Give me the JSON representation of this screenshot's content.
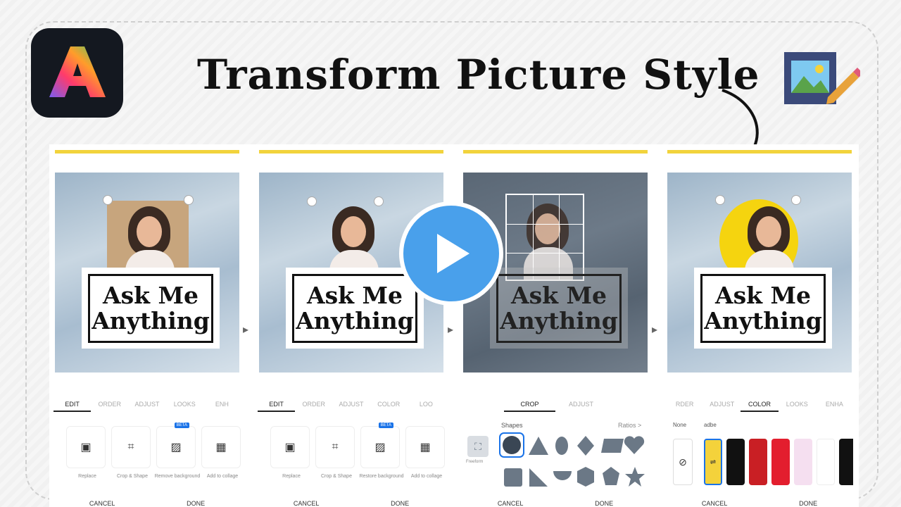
{
  "title": "Transform Picture Style",
  "panels": [
    {
      "tabs": [
        "EDIT",
        "ORDER",
        "ADJUST",
        "LOOKS",
        "ENH"
      ],
      "active": 0,
      "canvas_text": [
        "Ask Me",
        "Anything"
      ],
      "tools": [
        {
          "label": "Replace",
          "icon": "replace-icon"
        },
        {
          "label": "Crop & Shape",
          "icon": "crop-icon"
        },
        {
          "label": "Remove background",
          "icon": "remove-bg-icon",
          "badge": "BETA"
        },
        {
          "label": "Add to collage",
          "icon": "collage-icon"
        }
      ],
      "cancel": "CANCEL",
      "done": "DONE"
    },
    {
      "tabs": [
        "EDIT",
        "ORDER",
        "ADJUST",
        "COLOR",
        "LOO"
      ],
      "active": 0,
      "canvas_text": [
        "Ask Me",
        "Anything"
      ],
      "tools": [
        {
          "label": "Replace",
          "icon": "replace-icon"
        },
        {
          "label": "Crop & Shape",
          "icon": "crop-icon"
        },
        {
          "label": "Restore background",
          "icon": "restore-bg-icon",
          "badge": "BETA"
        },
        {
          "label": "Add to collage",
          "icon": "collage-icon"
        }
      ],
      "cancel": "CANCEL",
      "done": "DONE"
    },
    {
      "tabs": [
        "CROP",
        "ADJUST"
      ],
      "active": 0,
      "canvas_text": [
        "Ask Me",
        "Anything"
      ],
      "shapes_label": "Shapes",
      "ratios_label": "Ratios >",
      "freeform_label": "Freeform",
      "cancel": "CANCEL",
      "done": "DONE"
    },
    {
      "tabs": [
        "RDER",
        "ADJUST",
        "COLOR",
        "LOOKS",
        "ENHA"
      ],
      "active": 2,
      "canvas_text": [
        "Ask Me",
        "Anything"
      ],
      "color_options": [
        "None",
        "adbe"
      ],
      "swatch_colors": [
        "#f4d23b",
        "#111111",
        "#c91f24",
        "#e31e2e",
        "#f5dff0",
        "#ffffff",
        "#111111"
      ],
      "cancel": "CANCEL",
      "done": "DONE"
    }
  ]
}
